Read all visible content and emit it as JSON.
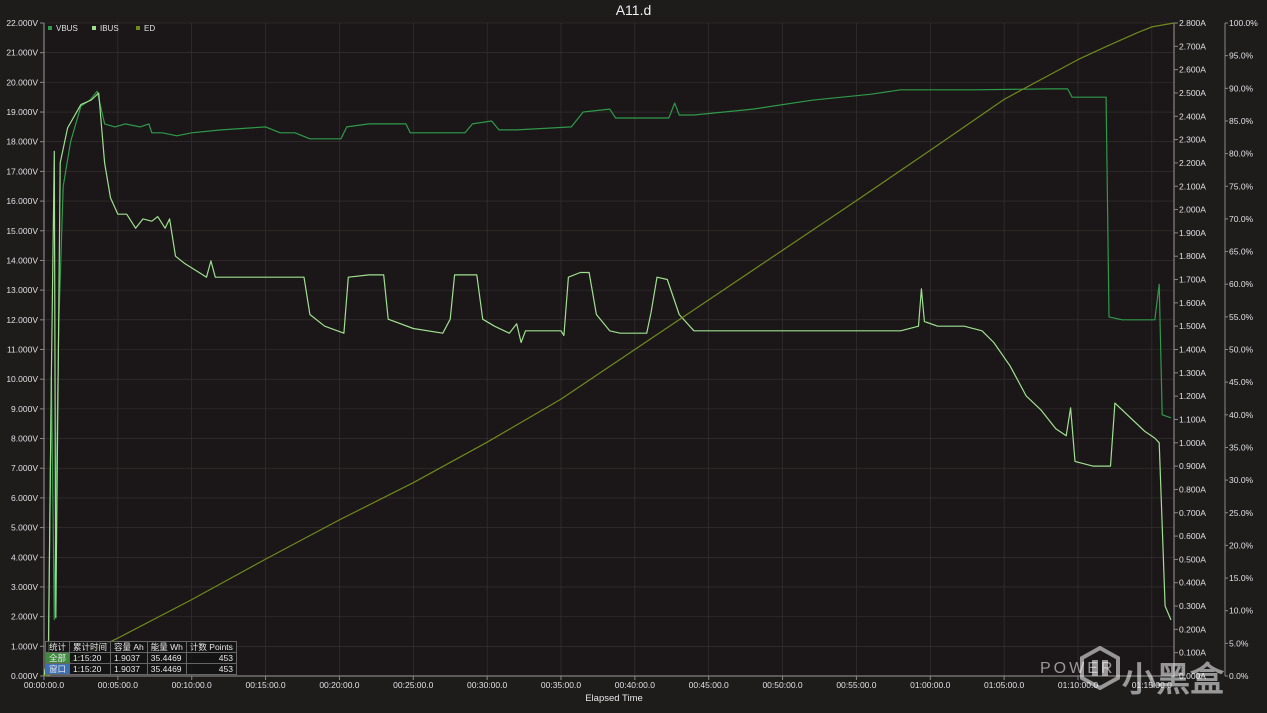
{
  "title": "A11.d",
  "xlabel": "Elapsed Time",
  "legend": [
    {
      "name": "VBUS",
      "color": "#2e9a4a"
    },
    {
      "name": "IBUS",
      "color": "#9ee08f"
    },
    {
      "name": "ED",
      "color": "#6e8a1e"
    }
  ],
  "watermark": {
    "latin": "POWER",
    "cn": "小黑盒"
  },
  "stats": {
    "headers": [
      "统计",
      "累计时间",
      "容量 Ah",
      "能量 Wh",
      "计数 Points"
    ],
    "rows": [
      {
        "label": "全部",
        "time": "1:15:20",
        "ah": "1.9037",
        "wh": "35.4469",
        "points": "453"
      },
      {
        "label": "窗口",
        "time": "1:15:20",
        "ah": "1.9037",
        "wh": "35.4469",
        "points": "453"
      }
    ]
  },
  "chart_data": {
    "type": "line",
    "title": "A11.d",
    "xlabel": "Elapsed Time",
    "x_unit": "minutes",
    "xlim": [
      0,
      76.5
    ],
    "x_ticks": [
      "00:00:00.0",
      "00:05:00.0",
      "00:10:00.0",
      "00:15:00.0",
      "00:20:00.0",
      "00:25:00.0",
      "00:30:00.0",
      "00:35:00.0",
      "00:40:00.0",
      "00:45:00.0",
      "00:50:00.0",
      "00:55:00.0",
      "01:00:00.0",
      "01:05:00.0",
      "01:10:00.0",
      "01:15:00.0"
    ],
    "axes": {
      "left": {
        "unit": "V",
        "ylim": [
          0,
          22
        ],
        "ticks": [
          "0.000V",
          "1.000V",
          "2.000V",
          "3.000V",
          "4.000V",
          "5.000V",
          "6.000V",
          "7.000V",
          "8.000V",
          "9.000V",
          "10.000V",
          "11.000V",
          "12.000V",
          "13.000V",
          "14.000V",
          "15.000V",
          "16.000V",
          "17.000V",
          "18.000V",
          "19.000V",
          "20.000V",
          "21.000V",
          "22.000V"
        ]
      },
      "right1": {
        "unit": "A",
        "ylim": [
          0,
          2.8
        ],
        "ticks": [
          "0.000A",
          "0.100A",
          "0.200A",
          "0.300A",
          "0.400A",
          "0.500A",
          "0.600A",
          "0.700A",
          "0.800A",
          "0.900A",
          "1.000A",
          "1.100A",
          "1.200A",
          "1.300A",
          "1.400A",
          "1.500A",
          "1.600A",
          "1.700A",
          "1.800A",
          "1.900A",
          "2.000A",
          "2.100A",
          "2.200A",
          "2.300A",
          "2.400A",
          "2.500A",
          "2.600A",
          "2.700A",
          "2.800A"
        ]
      },
      "right2": {
        "unit": "%",
        "ylim": [
          0,
          100
        ],
        "ticks": [
          "0.0%",
          "5.0%",
          "10.0%",
          "15.0%",
          "20.0%",
          "25.0%",
          "30.0%",
          "35.0%",
          "40.0%",
          "45.0%",
          "50.0%",
          "55.0%",
          "60.0%",
          "65.0%",
          "70.0%",
          "75.0%",
          "80.0%",
          "85.0%",
          "90.0%",
          "95.0%",
          "100.0%"
        ]
      }
    },
    "grid": true,
    "legend_position": "top-left",
    "series": [
      {
        "name": "VBUS",
        "axis": "left",
        "color": "#2e9a4a",
        "points": [
          [
            0,
            0
          ],
          [
            0.3,
            0.5
          ],
          [
            0.5,
            10.1
          ],
          [
            0.7,
            1.9
          ],
          [
            1,
            11.9
          ],
          [
            1.3,
            16.5
          ],
          [
            1.8,
            18
          ],
          [
            2.5,
            19.2
          ],
          [
            3.1,
            19.4
          ],
          [
            3.6,
            19.7
          ],
          [
            4.1,
            18.6
          ],
          [
            4.8,
            18.5
          ],
          [
            5.5,
            18.6
          ],
          [
            6.5,
            18.5
          ],
          [
            7.1,
            18.6
          ],
          [
            7.3,
            18.3
          ],
          [
            8,
            18.3
          ],
          [
            9,
            18.2
          ],
          [
            10,
            18.3
          ],
          [
            12,
            18.4
          ],
          [
            15,
            18.5
          ],
          [
            16,
            18.3
          ],
          [
            17,
            18.3
          ],
          [
            18,
            18.1
          ],
          [
            20.1,
            18.1
          ],
          [
            20.5,
            18.5
          ],
          [
            22,
            18.6
          ],
          [
            24.5,
            18.6
          ],
          [
            24.8,
            18.3
          ],
          [
            27,
            18.3
          ],
          [
            28.5,
            18.3
          ],
          [
            29,
            18.6
          ],
          [
            30.3,
            18.7
          ],
          [
            30.8,
            18.4
          ],
          [
            32,
            18.4
          ],
          [
            35.7,
            18.5
          ],
          [
            36.5,
            19
          ],
          [
            38.3,
            19.1
          ],
          [
            38.7,
            18.8
          ],
          [
            42.3,
            18.8
          ],
          [
            42.7,
            19.3
          ],
          [
            43,
            18.9
          ],
          [
            44,
            18.9
          ],
          [
            48,
            19.1
          ],
          [
            52,
            19.4
          ],
          [
            56,
            19.6
          ],
          [
            58,
            19.75
          ],
          [
            63,
            19.75
          ],
          [
            68,
            19.78
          ],
          [
            69.3,
            19.78
          ],
          [
            69.6,
            19.5
          ],
          [
            71.3,
            19.5
          ],
          [
            71.9,
            19.5
          ],
          [
            72.1,
            12.1
          ],
          [
            73,
            12
          ],
          [
            74.5,
            12
          ],
          [
            75.2,
            12
          ],
          [
            75.5,
            13.2
          ],
          [
            75.7,
            8.8
          ],
          [
            76.3,
            8.7
          ]
        ]
      },
      {
        "name": "IBUS",
        "axis": "right1",
        "color": "#9ee08f",
        "points": [
          [
            0,
            0
          ],
          [
            0.3,
            0.1
          ],
          [
            0.5,
            1.3
          ],
          [
            0.7,
            2.25
          ],
          [
            0.8,
            0.25
          ],
          [
            1.1,
            2.2
          ],
          [
            1.6,
            2.35
          ],
          [
            2.5,
            2.45
          ],
          [
            3.2,
            2.47
          ],
          [
            3.7,
            2.5
          ],
          [
            4.1,
            2.2
          ],
          [
            4.5,
            2.05
          ],
          [
            5,
            1.98
          ],
          [
            5.6,
            1.98
          ],
          [
            6.2,
            1.92
          ],
          [
            6.7,
            1.96
          ],
          [
            7.3,
            1.95
          ],
          [
            7.7,
            1.97
          ],
          [
            8.2,
            1.92
          ],
          [
            8.5,
            1.96
          ],
          [
            8.9,
            1.8
          ],
          [
            9.5,
            1.77
          ],
          [
            10.5,
            1.73
          ],
          [
            11,
            1.71
          ],
          [
            11.3,
            1.78
          ],
          [
            11.6,
            1.71
          ],
          [
            14,
            1.71
          ],
          [
            16,
            1.71
          ],
          [
            17.6,
            1.71
          ],
          [
            18,
            1.55
          ],
          [
            19,
            1.5
          ],
          [
            20.3,
            1.47
          ],
          [
            20.6,
            1.71
          ],
          [
            22,
            1.72
          ],
          [
            23,
            1.72
          ],
          [
            23.3,
            1.53
          ],
          [
            25,
            1.49
          ],
          [
            27,
            1.47
          ],
          [
            27.5,
            1.53
          ],
          [
            27.8,
            1.72
          ],
          [
            29.3,
            1.72
          ],
          [
            29.7,
            1.53
          ],
          [
            30.5,
            1.5
          ],
          [
            31.5,
            1.47
          ],
          [
            32,
            1.51
          ],
          [
            32.3,
            1.43
          ],
          [
            32.6,
            1.48
          ],
          [
            35,
            1.48
          ],
          [
            35.2,
            1.46
          ],
          [
            35.5,
            1.71
          ],
          [
            36.3,
            1.73
          ],
          [
            36.9,
            1.73
          ],
          [
            37.4,
            1.55
          ],
          [
            38.3,
            1.48
          ],
          [
            39,
            1.47
          ],
          [
            40.8,
            1.47
          ],
          [
            41.1,
            1.56
          ],
          [
            41.5,
            1.71
          ],
          [
            42.2,
            1.7
          ],
          [
            43,
            1.55
          ],
          [
            44,
            1.48
          ],
          [
            50,
            1.48
          ],
          [
            58,
            1.48
          ],
          [
            59.2,
            1.5
          ],
          [
            59.4,
            1.66
          ],
          [
            59.6,
            1.52
          ],
          [
            60.5,
            1.5
          ],
          [
            62.3,
            1.5
          ],
          [
            63.5,
            1.48
          ],
          [
            64.3,
            1.43
          ],
          [
            65.4,
            1.33
          ],
          [
            66.5,
            1.2
          ],
          [
            67.5,
            1.14
          ],
          [
            68.5,
            1.06
          ],
          [
            69.2,
            1.03
          ],
          [
            69.5,
            1.15
          ],
          [
            69.8,
            0.92
          ],
          [
            71,
            0.9
          ],
          [
            71.3,
            0.9
          ],
          [
            72.2,
            0.9
          ],
          [
            72.5,
            1.17
          ],
          [
            74.5,
            1.05
          ],
          [
            75.2,
            1.02
          ],
          [
            75.5,
            1.0
          ],
          [
            75.9,
            0.3
          ],
          [
            76.3,
            0.24
          ]
        ]
      },
      {
        "name": "ED",
        "axis": "right2",
        "color": "#6e8a1e",
        "points": [
          [
            0,
            0
          ],
          [
            1,
            0.5
          ],
          [
            2,
            2.5
          ],
          [
            5,
            5.8
          ],
          [
            10,
            11.7
          ],
          [
            15,
            17.9
          ],
          [
            20,
            23.9
          ],
          [
            25,
            29.6
          ],
          [
            30,
            35.8
          ],
          [
            35,
            42.4
          ],
          [
            40,
            50
          ],
          [
            45,
            57.6
          ],
          [
            50,
            65.2
          ],
          [
            55,
            72.8
          ],
          [
            60,
            80.5
          ],
          [
            65,
            88.3
          ],
          [
            70,
            94.4
          ],
          [
            72,
            96.5
          ],
          [
            74,
            98.5
          ],
          [
            75,
            99.4
          ],
          [
            76.5,
            100
          ]
        ]
      }
    ]
  }
}
